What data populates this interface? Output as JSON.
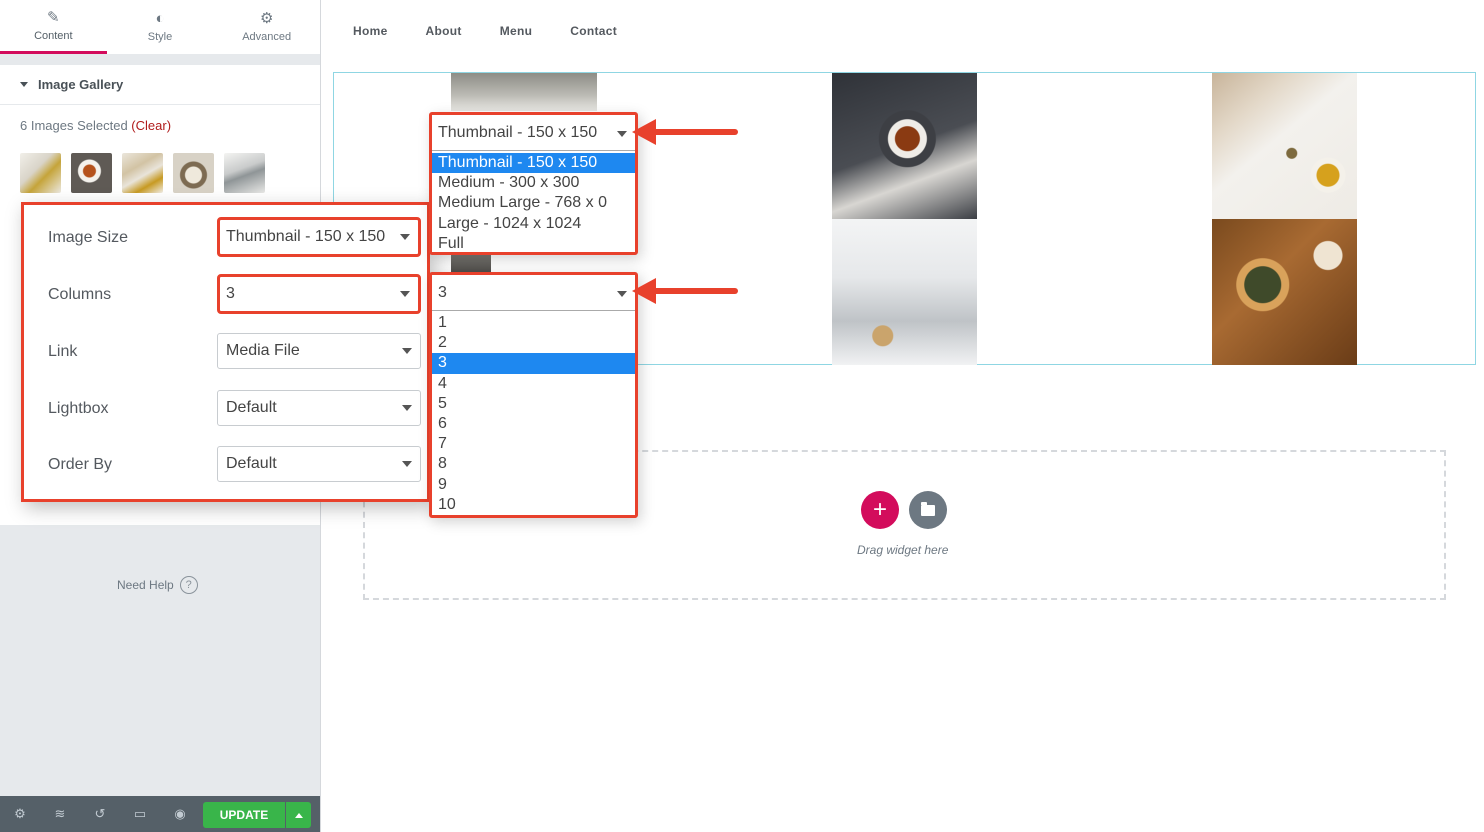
{
  "panel": {
    "tabs": [
      {
        "label": "Content",
        "icon": "pencil-icon"
      },
      {
        "label": "Style",
        "icon": "half-circle-icon"
      },
      {
        "label": "Advanced",
        "icon": "gear-icon"
      }
    ],
    "section_title": "Image Gallery",
    "selected_text": "6 Images Selected ",
    "clear_label": "(Clear)",
    "need_help": "Need Help",
    "update_label": "UPDATE"
  },
  "callout": {
    "rows": [
      {
        "label": "Image Size",
        "value": "Thumbnail - 150 x 150"
      },
      {
        "label": "Columns",
        "value": "3"
      },
      {
        "label": "Link",
        "value": "Media File"
      },
      {
        "label": "Lightbox",
        "value": "Default"
      },
      {
        "label": "Order By",
        "value": "Default"
      }
    ]
  },
  "size_dropdown": {
    "current": "Thumbnail - 150 x 150",
    "options": [
      "Thumbnail - 150 x 150",
      "Medium - 300 x 300",
      "Medium Large - 768 x 0",
      "Large - 1024 x 1024",
      "Full"
    ],
    "selected_index": 0
  },
  "columns_dropdown": {
    "current": "3",
    "options": [
      "1",
      "2",
      "3",
      "4",
      "5",
      "6",
      "7",
      "8",
      "9",
      "10"
    ],
    "selected_index": 2
  },
  "nav": [
    "Home",
    "About",
    "Menu",
    "Contact"
  ],
  "drop_zone": {
    "text": "Drag widget here"
  },
  "colors": {
    "accent": "#d30c5c",
    "update": "#39b54a",
    "highlight": "#e8412c",
    "selected_option": "#1e88f0"
  }
}
